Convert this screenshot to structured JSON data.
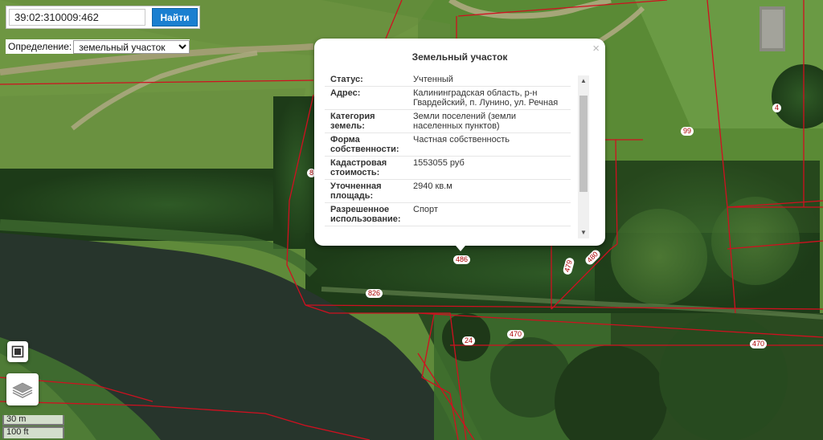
{
  "search": {
    "value": "39:02:310009:462",
    "button_label": "Найти"
  },
  "definition": {
    "label": "Определение:",
    "selected": "земельный участок"
  },
  "popup": {
    "title": "Земельный участок",
    "close": "×",
    "rows": [
      {
        "key": "Статус:",
        "value": "Учтенный"
      },
      {
        "key": "Адрес:",
        "value": "Калининградская область, р-н Гвардейский, п. Лунино, ул. Речная"
      },
      {
        "key": "Категория земель:",
        "value": "Земли поселений (земли населенных пунктов)"
      },
      {
        "key": "Форма собственности:",
        "value": "Частная собственность"
      },
      {
        "key": "Кадастровая стоимость:",
        "value": "1553055 руб"
      },
      {
        "key": "Уточненная площадь:",
        "value": "2940 кв.м"
      },
      {
        "key": "Разрешенное использование:",
        "value": "Спорт"
      }
    ]
  },
  "parcel_labels": [
    "4",
    "99",
    "8",
    "486",
    "479",
    "480",
    "826",
    "24",
    "470",
    "470",
    "470"
  ],
  "scale": {
    "metric": "30 m",
    "imperial": "100 ft"
  },
  "icons": {
    "layers": "layers-icon",
    "map": "map-frame-icon",
    "up": "scroll-up-icon",
    "down": "scroll-down-icon"
  },
  "colors": {
    "parcel_border": "#d01020",
    "button": "#1a7fd0",
    "label_text": "#a00000"
  }
}
